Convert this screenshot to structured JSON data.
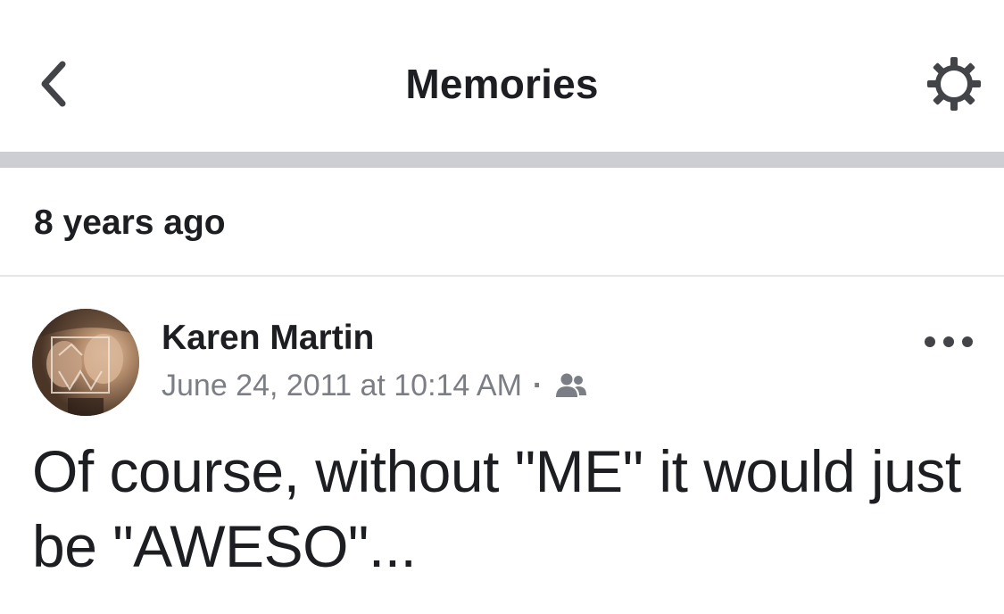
{
  "header": {
    "title": "Memories",
    "back_icon": "chevron-left-icon",
    "settings_icon": "gear-icon"
  },
  "section": {
    "label": "8 years ago"
  },
  "post": {
    "author": "Karen Martin",
    "timestamp": "June 24, 2011 at 10:14 AM",
    "separator": "·",
    "audience_icon": "friends-icon",
    "more_icon": "more-horizontal-icon",
    "text": "Of course, without \"ME\" it would just be \"AWESO\"..."
  },
  "colors": {
    "text_primary": "#1c1e21",
    "text_secondary": "#7b7e84",
    "divider_thick": "#cdced3",
    "divider_thin": "#e4e5e8",
    "icon": "#424448"
  }
}
